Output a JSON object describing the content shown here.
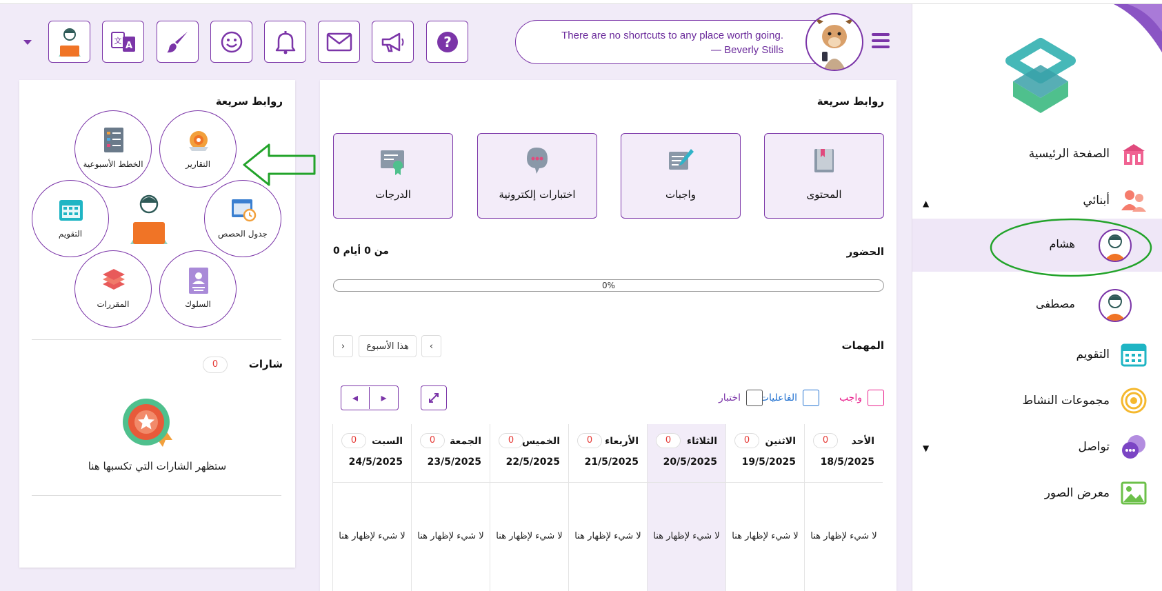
{
  "header": {
    "quote_line1": "There are no shortcuts to any place worth going.",
    "quote_line2": "— Beverly Stills"
  },
  "sidebar": {
    "home": "الصفحة الرئيسية",
    "children_section": "أبنائي",
    "children": [
      {
        "name": "هشام",
        "active": true
      },
      {
        "name": "مصطفى",
        "active": false
      }
    ],
    "calendar": "التقويم",
    "activity_groups": "مجموعات النشاط",
    "communication": "تواصل",
    "gallery": "معرض الصور"
  },
  "main": {
    "quick_links_title": "روابط سريعة",
    "quick_links": [
      {
        "label": "المحتوى",
        "icon": "book-icon"
      },
      {
        "label": "واجبات",
        "icon": "assignment-icon"
      },
      {
        "label": "اختبارات إلكترونية",
        "icon": "quiz-icon"
      },
      {
        "label": "الدرجات",
        "icon": "certificate-icon"
      }
    ],
    "attendance_title": "الحضور",
    "attendance_summary": "0 من 0 أيام",
    "attendance_progress_text": "0%",
    "attendance_progress": 0,
    "tasks_title": "المهمات",
    "week_button": "هذا الأسبوع",
    "filters": [
      {
        "label": "واجب",
        "color": "#e91e8c"
      },
      {
        "label": "الفاعليات",
        "color": "#1e6fd0"
      },
      {
        "label": "اختبار",
        "color": "#7b35a8"
      }
    ],
    "days": [
      {
        "name": "الأحد",
        "date": "18/5/2025",
        "count": "0",
        "empty": "لا شيء لإظهار هنا"
      },
      {
        "name": "الاثنين",
        "date": "19/5/2025",
        "count": "0",
        "empty": "لا شيء لإظهار هنا"
      },
      {
        "name": "الثلاثاء",
        "date": "20/5/2025",
        "count": "0",
        "empty": "لا شيء لإظهار هنا",
        "today": true
      },
      {
        "name": "الأربعاء",
        "date": "21/5/2025",
        "count": "0",
        "empty": "لا شيء لإظهار هنا"
      },
      {
        "name": "الخميس",
        "date": "22/5/2025",
        "count": "0",
        "empty": "لا شيء لإظهار هنا"
      },
      {
        "name": "الجمعة",
        "date": "23/5/2025",
        "count": "0",
        "empty": "لا شيء لإظهار هنا"
      },
      {
        "name": "السبت",
        "date": "24/5/2025",
        "count": "0",
        "empty": "لا شيء لإظهار هنا"
      }
    ]
  },
  "side": {
    "quick_links_title": "روابط سريعة",
    "circles": {
      "reports": "التقارير",
      "weekly_plans": "الخطط الأسبوعية",
      "calendar": "التقويم",
      "timetable": "جدول الحصص",
      "courses": "المقررات",
      "behavior": "السلوك"
    },
    "badges_title": "شارات",
    "badges_count": "0",
    "badges_empty": "ستظهر الشارات التي تكسبها هنا"
  },
  "colors": {
    "accent": "#7b35a8",
    "count_red": "#e53935",
    "arrow_green": "#22a32a"
  }
}
